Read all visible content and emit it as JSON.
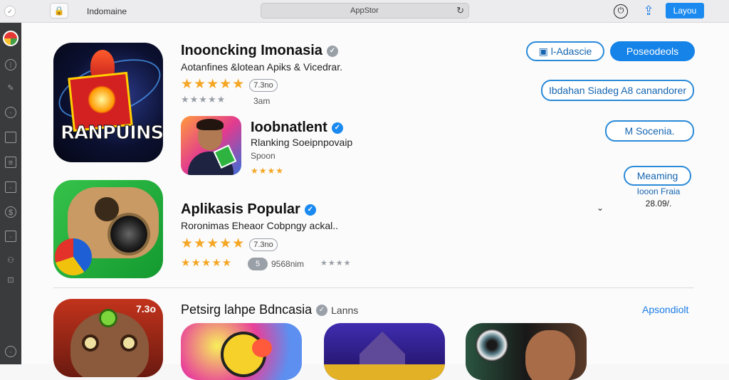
{
  "topbar": {
    "title": "Indomaine",
    "search_text": "AppStor",
    "button_label": "Layou"
  },
  "sections": {
    "featured": {
      "app1": {
        "title": "Inooncking Imonasia",
        "subtitle": "Aotanfines &lotean  Apiks &  Vicedrar.",
        "rating_pill": "7.3no",
        "meta": "3am",
        "icon_text": "RANPUINS"
      },
      "app2": {
        "title": "Ioobnatlent",
        "subtitle": "Rlanking  Soeipnpovaip",
        "meta": "Spoon"
      },
      "app3": {
        "title": "Aplikasis Popular",
        "subtitle": "Roronimas Eheaor  Cobpngy ackal..",
        "rating_pill": "7.3no",
        "pill2": "5",
        "meta": "9568nim"
      }
    },
    "bottom": {
      "title": "Petsirg lahpe Bdncasia",
      "suffix": "Lanns",
      "tag": "7.3o",
      "link": "Apsondiolt"
    }
  },
  "right_panel": {
    "btn1": "l-Adascie",
    "btn2": "Poseodeols",
    "btn3": "Ibdahan Siadeg A8 canandorer",
    "btn4": "M  Socenia.",
    "btn5": "Meaming",
    "note1": "Iooon Fraia",
    "note2": "28.09/."
  },
  "colors": {
    "accent": "#1a8af0",
    "star": "#f5a623"
  }
}
